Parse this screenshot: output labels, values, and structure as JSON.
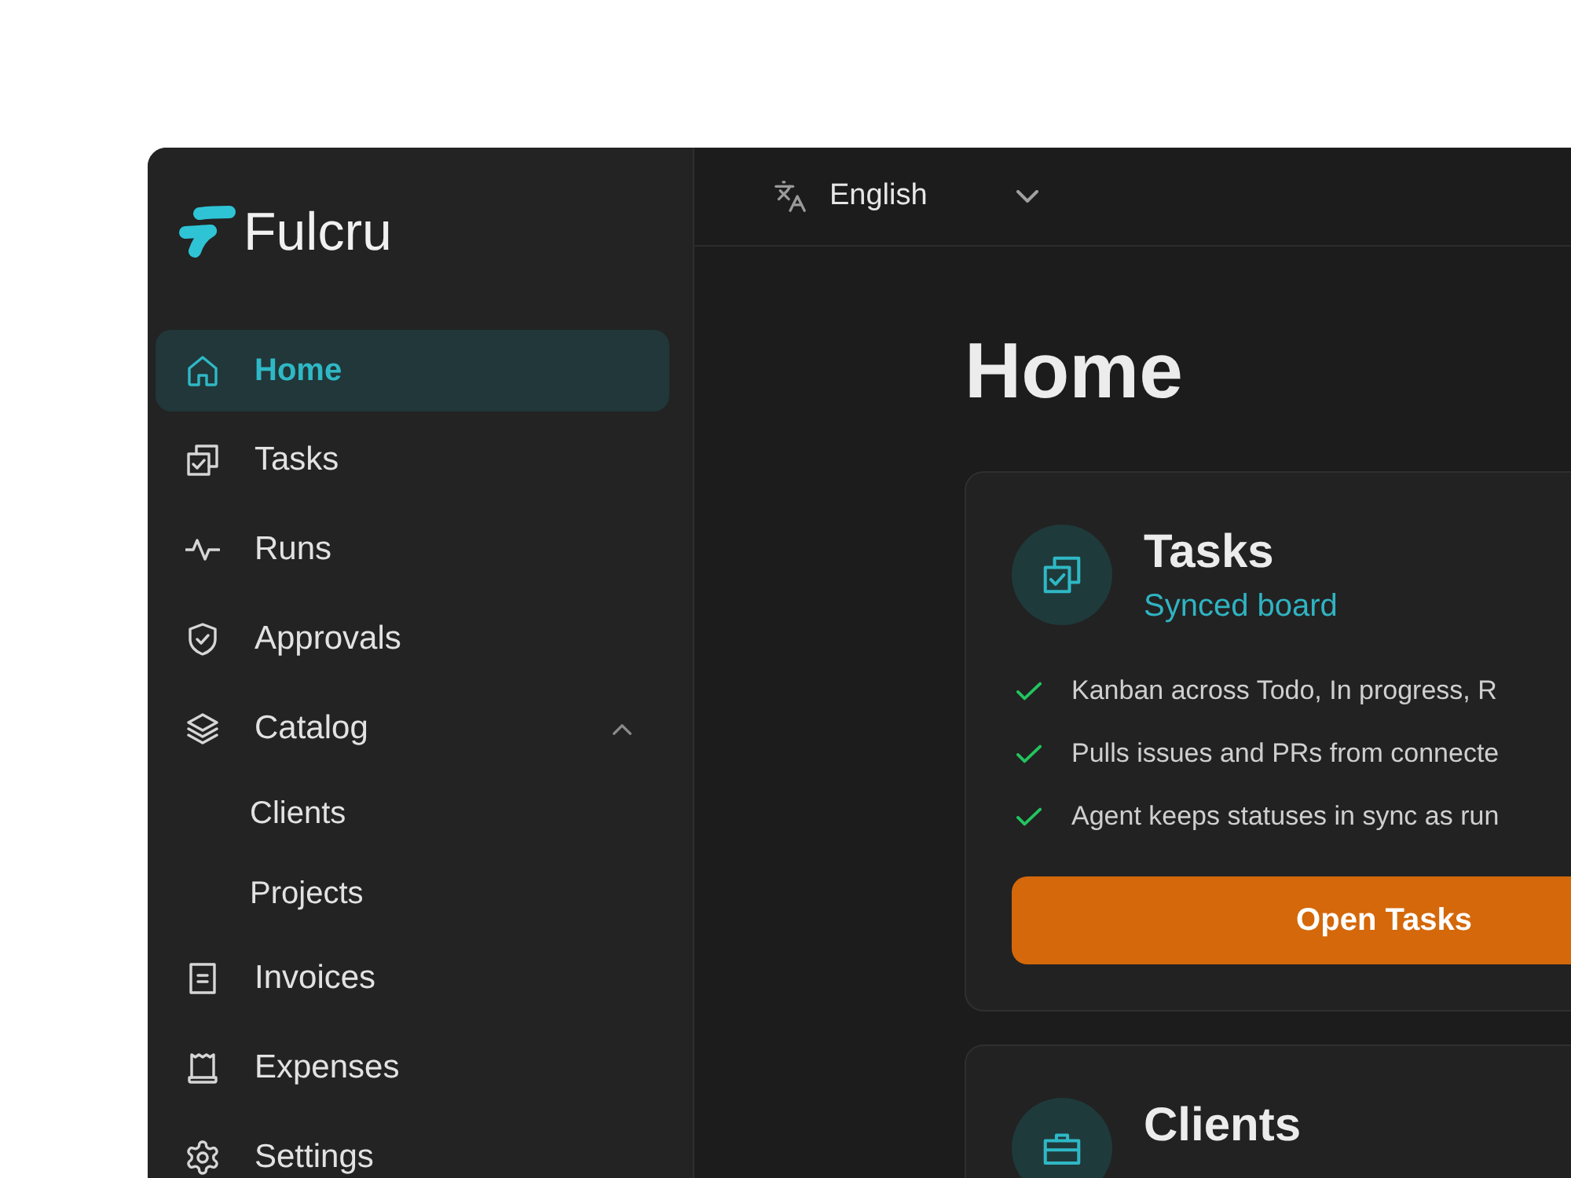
{
  "sidebar": {
    "logo": {
      "text": "Fulcru"
    },
    "items": [
      {
        "label": "Home",
        "selected": true
      },
      {
        "label": "Tasks",
        "selected": false
      },
      {
        "label": "Runs",
        "selected": false
      },
      {
        "label": "Approvals",
        "selected": false
      },
      {
        "label": "Catalog",
        "selected": false,
        "expanded": true,
        "children": [
          {
            "label": "Clients",
            "selected": false
          },
          {
            "label": "Projects",
            "selected": false
          }
        ]
      },
      {
        "label": "Invoices",
        "selected": false
      },
      {
        "label": "Expenses",
        "selected": false
      },
      {
        "label": "Settings",
        "selected": false
      }
    ]
  },
  "top_bar": {
    "language_select": {
      "value": "English"
    }
  },
  "page": {
    "title": "Home"
  },
  "cards": [
    {
      "title": "Tasks",
      "subtitle": "Synced board",
      "features": [
        "Kanban across Todo, In progress, R",
        "Pulls issues and PRs from connecte",
        "Agent keeps statuses in sync as run"
      ],
      "button": "Open Tasks"
    },
    {
      "title": "Clients"
    }
  ]
}
